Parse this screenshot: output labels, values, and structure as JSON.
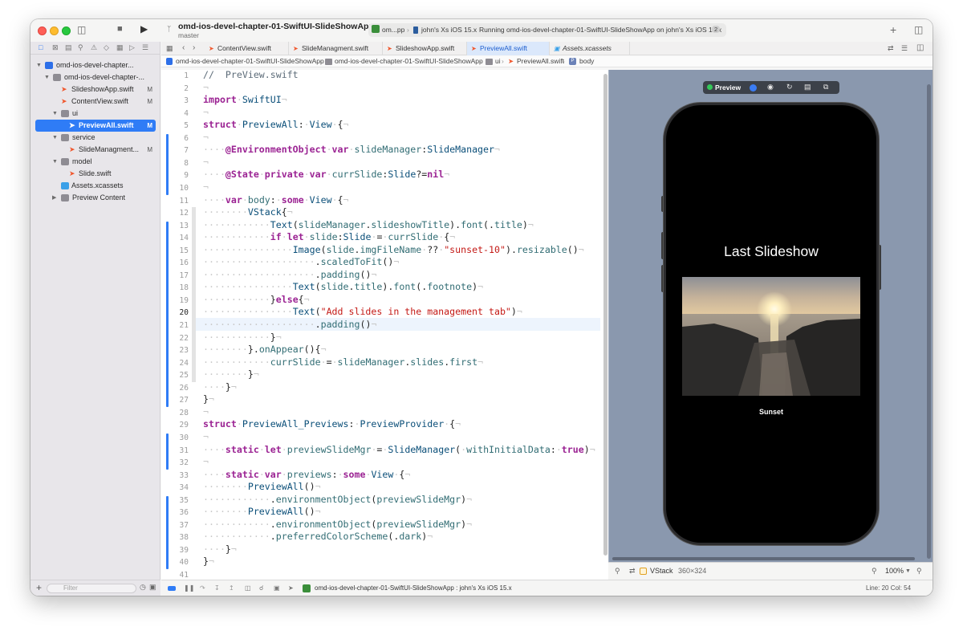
{
  "window": {
    "project_title": "omd-ios-devel-chapter-01-SwiftUI-SlideShowApp",
    "branch": "master"
  },
  "toolbar": {
    "scheme": "om...pp",
    "destination": "john's Xs iOS 15.x",
    "status": "Running omd-ios-devel-chapter-01-SwiftUI-SlideShowApp on john's Xs iOS 15.x",
    "status_count": "2"
  },
  "navigator": {
    "items": [
      {
        "label": "omd-ios-devel-chapter...",
        "kind": "project",
        "mark": ""
      },
      {
        "label": "omd-ios-devel-chapter-...",
        "kind": "folder",
        "mark": ""
      },
      {
        "label": "SlideshowApp.swift",
        "kind": "swift",
        "mark": "M"
      },
      {
        "label": "ContentView.swift",
        "kind": "swift",
        "mark": "M"
      },
      {
        "label": "ui",
        "kind": "folder",
        "mark": ""
      },
      {
        "label": "PreviewAll.swift",
        "kind": "swift",
        "mark": "M",
        "selected": true
      },
      {
        "label": "service",
        "kind": "folder",
        "mark": ""
      },
      {
        "label": "SlideManagment...",
        "kind": "swift",
        "mark": "M"
      },
      {
        "label": "model",
        "kind": "folder",
        "mark": ""
      },
      {
        "label": "Slide.swift",
        "kind": "swift",
        "mark": ""
      },
      {
        "label": "Assets.xcassets",
        "kind": "asset",
        "mark": ""
      },
      {
        "label": "Preview Content",
        "kind": "folder",
        "mark": ""
      }
    ],
    "filter_placeholder": "Filter"
  },
  "tabs": [
    {
      "label": "ContentView.swift",
      "active": false
    },
    {
      "label": "SlideManagment.swift",
      "active": false
    },
    {
      "label": "SlideshowApp.swift",
      "active": false
    },
    {
      "label": "PreviewAll.swift",
      "active": true
    },
    {
      "label": "Assets.xcassets",
      "active": false,
      "italic": true
    }
  ],
  "breadcrumb": {
    "project": "omd-ios-devel-chapter-01-SwiftUI-SlideShowApp",
    "group": "omd-ios-devel-chapter-01-SwiftUI-SlideShowApp",
    "folder": "ui",
    "file": "PreviewAll.swift",
    "symbol": "body"
  },
  "editor": {
    "current_line": 20,
    "lines": [
      "//  PreView.swift",
      "",
      "import SwiftUI",
      "",
      "struct PreviewAll: View {",
      "",
      "    @EnvironmentObject var slideManager:SlideManager",
      "",
      "    @State private var currSlide:Slide?=nil",
      "",
      "    var body: some View {",
      "        VStack{",
      "            Text(slideManager.slideshowTitle).font(.title)",
      "            if let slide:Slide = currSlide {",
      "                Image(slide.imgFileName ?? \"sunset-10\").resizable()",
      "                    .scaledToFit()",
      "                    .padding()",
      "                Text(slide.title).font(.footnote)",
      "            }else{",
      "                Text(\"Add slides in the management tab\")",
      "                    .padding()",
      "            }",
      "        }.onAppear(){",
      "            currSlide = slideManager.slides.first",
      "        }",
      "    }",
      "}",
      "",
      "struct PreviewAll_Previews: PreviewProvider {",
      "",
      "    static let previewSlideMgr = SlideManager( withInitialData: true)",
      "",
      "    static var previews: some View {",
      "        PreviewAll()",
      "            .environmentObject(previewSlideMgr)",
      "        PreviewAll()",
      "            .environmentObject(previewSlideMgr)",
      "            .preferredColorScheme(.dark)",
      "    }",
      "}",
      ""
    ]
  },
  "preview": {
    "mode_label": "Preview",
    "slideshow_title": "Last Slideshow",
    "slide_caption": "Sunset",
    "selection_label": "VStack",
    "selection_size": "360×324",
    "zoom": "100%"
  },
  "debugbar": {
    "scheme_target": "omd-ios-devel-chapter-01-SwiftUI-SlideShowApp : john's Xs iOS 15.x",
    "cursor": "Line: 20  Col: 54"
  },
  "colors": {
    "accent": "#2f7cf6",
    "keyword": "#9b2393",
    "string": "#c41a16",
    "type": "#0b4f79",
    "canvas_bg": "#8a98ae"
  }
}
